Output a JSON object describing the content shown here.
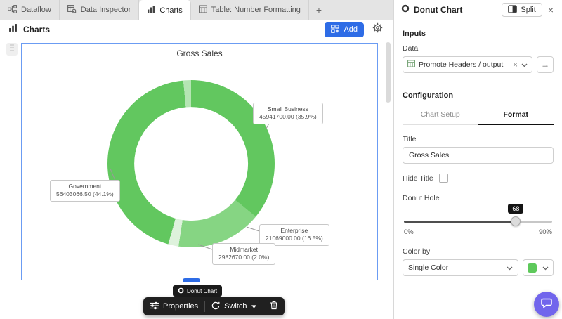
{
  "colors": {
    "accent-blue": "#2e6ce6",
    "selection-blue": "#6b9cf3",
    "fab-purple": "#7165ec"
  },
  "icons": {
    "close": "×",
    "clear": "×",
    "open_output": "→",
    "new_tab": "+"
  },
  "tab_bar": {
    "tabs": [
      {
        "label": "Dataflow"
      },
      {
        "label": "Data Inspector"
      },
      {
        "label": "Charts"
      },
      {
        "label": "Table: Number Formatting"
      }
    ]
  },
  "main_toolbar": {
    "title": "Charts",
    "add_label": "Add"
  },
  "canvas": {
    "selection_badge": "Donut Chart",
    "floating_toolbar": {
      "properties_label": "Properties",
      "switch_label": "Switch"
    }
  },
  "chart_data": {
    "type": "pie",
    "title": "Gross Sales",
    "donut_hole_percent": 68,
    "single_color": "#5ec95b",
    "legend_position": "callouts",
    "segments": [
      {
        "label": "Small Business",
        "value": 45941700.0,
        "percent": 35.9,
        "display": "45941700.00 (35.9%)",
        "color": "#62c75f"
      },
      {
        "label": "Enterprise",
        "value": 21069000.0,
        "percent": 16.5,
        "display": "21069000.00 (16.5%)",
        "color": "#86d583"
      },
      {
        "label": "Midmarket",
        "value": 2982670.0,
        "percent": 2.0,
        "display": "2982670.00 (2.0%)",
        "color": "#def2dc"
      },
      {
        "label": "Government",
        "value": 56403066.5,
        "percent": 44.1,
        "display": "56403066.50 (44.1%)",
        "color": "#62c75f"
      },
      {
        "label": "",
        "percent": 1.5,
        "display": "",
        "color": "#b5e5b3"
      }
    ]
  },
  "panel": {
    "title": "Donut Chart",
    "split_label": "Split",
    "sections": {
      "inputs_heading": "Inputs",
      "data_label": "Data",
      "data_value": "Promote Headers / output",
      "configuration_heading": "Configuration",
      "tab_chart_setup": "Chart Setup",
      "tab_format": "Format",
      "title_label": "Title",
      "title_value": "Gross Sales",
      "hide_title_label": "Hide Title",
      "donut_hole_label": "Donut Hole",
      "donut_hole_value": "68",
      "slider_min_label": "0%",
      "slider_max_label": "90%",
      "color_by_label": "Color by",
      "color_by_value": "Single Color"
    }
  }
}
